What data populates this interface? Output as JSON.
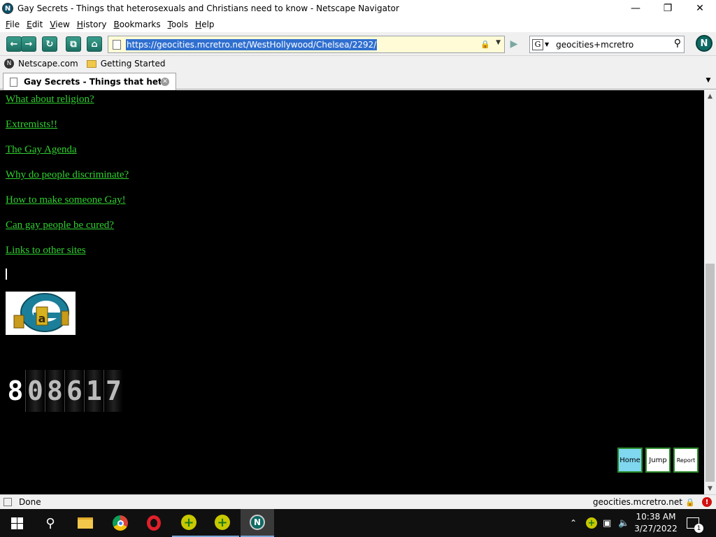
{
  "window": {
    "title": "Gay Secrets - Things that heterosexuals and Christians need to know - Netscape Navigator",
    "app_icon": "N"
  },
  "menu": [
    "File",
    "Edit",
    "View",
    "History",
    "Bookmarks",
    "Tools",
    "Help"
  ],
  "menu_access_keys": [
    "F",
    "E",
    "V",
    "H",
    "B",
    "T",
    "H"
  ],
  "toolbar": {
    "url": "https://geocities.mcretro.net/WestHollywood/Chelsea/2292/",
    "search_engine_icon": "G",
    "search_value": "geocities+mcretro",
    "logo": "N"
  },
  "bookmarks": [
    {
      "label": "Netscape.com",
      "icon": "netscape-icon"
    },
    {
      "label": "Getting Started",
      "icon": "folder-icon"
    }
  ],
  "tab": {
    "label": "Gay Secrets - Things that heteros..."
  },
  "page": {
    "links": [
      "What about religion?",
      "Extremists!!",
      "The Gay Agenda",
      "Why do people discriminate?",
      "How to make someone Gay!",
      "Can gay people be cured?",
      "Links to other sites"
    ],
    "counter_digits": [
      "8",
      "0",
      "8",
      "6",
      "1",
      "7"
    ],
    "tripod_buttons": [
      {
        "label": "Home",
        "color": "#7fd7f0"
      },
      {
        "label": "Jump",
        "color": "#ffffff"
      },
      {
        "label": "Report",
        "color": "#ffffff"
      }
    ],
    "link_color": "#2fd12f",
    "background": "#000000"
  },
  "status": {
    "text": "Done",
    "host": "geocities.mcretro.net"
  },
  "taskbar": {
    "clock_time": "10:38 AM",
    "clock_date": "3/27/2022",
    "notification_count": "1"
  }
}
